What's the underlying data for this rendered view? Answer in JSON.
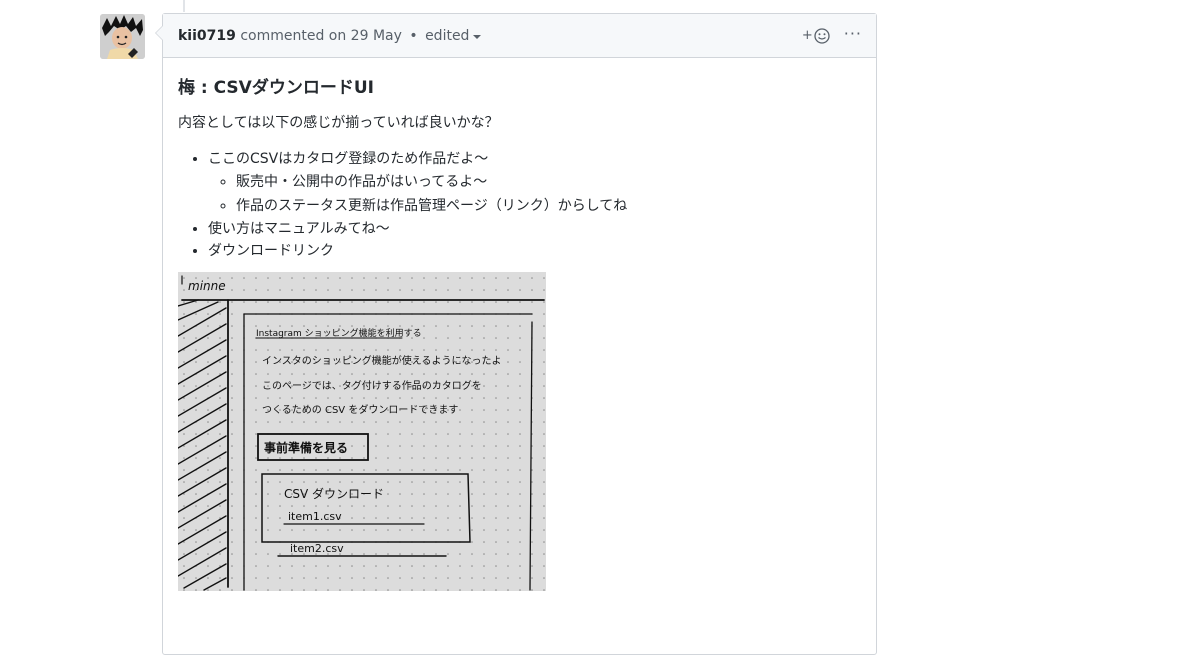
{
  "comment": {
    "author": "kii0719",
    "action": "commented on 29 May",
    "separator": "•",
    "edited_label": "edited",
    "reaction_plus": "+",
    "more_label": "···"
  },
  "body": {
    "heading": "梅 : CSVダウンロードUI",
    "intro": "内容としては以下の感じが揃っていれば良いかな？",
    "list": [
      {
        "text": "ここのCSVはカタログ登録のため作品だよ〜",
        "sub": [
          "販売中・公開中の作品がはいってるよ〜",
          "作品のステータス更新は作品管理ページ（リンク）からしてね"
        ]
      },
      {
        "text": "使い方はマニュアルみてね〜"
      },
      {
        "text": "ダウンロードリンク"
      }
    ]
  },
  "sketch": {
    "logo_text": "minne",
    "line1": "Instagram ショッピング機能を利用する",
    "line2": "インスタのショッピング機能が使えるようになったよ",
    "line3": "このページでは、タグ付けする作品のカタログを",
    "line4": "つくるための CSV をダウンロードできます",
    "button_text": "事前準備を見る",
    "box_title": "CSV ダウンロード",
    "file1": "item1.csv",
    "file2": "item2.csv"
  }
}
